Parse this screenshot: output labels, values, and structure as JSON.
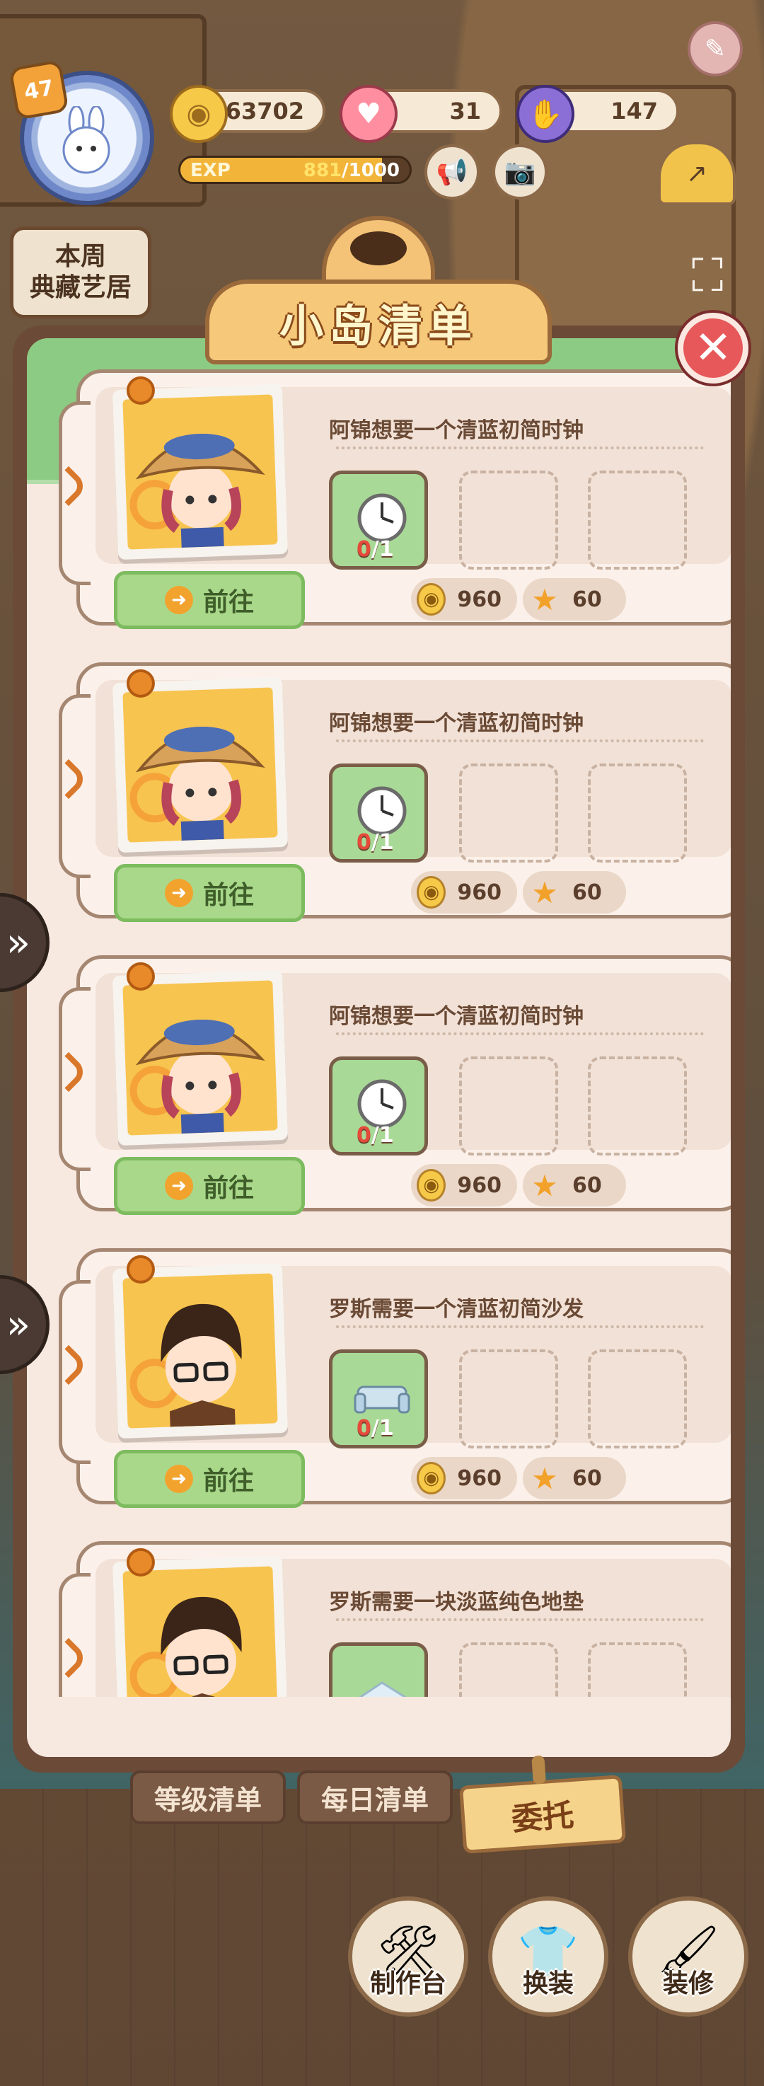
{
  "hud": {
    "level": "47",
    "coins": "63702",
    "hearts": "31",
    "gems": "147",
    "exp_label": "EXP",
    "exp_current": "881",
    "exp_sep_max": "/1000",
    "exp_fraction": 0.881,
    "weekly_line1": "本周",
    "weekly_line2": "典藏艺居"
  },
  "panel": {
    "title": "小岛清单",
    "close_symbol": "✕"
  },
  "tasks": [
    {
      "text": "阿锦想要一个清蓝初简时钟",
      "count_have": "0",
      "count_need": "/1",
      "item": "clock",
      "goto": "前往",
      "coin_reward": "960",
      "star_reward": "60",
      "character": "straw-hat-girl"
    },
    {
      "text": "阿锦想要一个清蓝初简时钟",
      "count_have": "0",
      "count_need": "/1",
      "item": "clock",
      "goto": "前往",
      "coin_reward": "960",
      "star_reward": "60",
      "character": "straw-hat-girl"
    },
    {
      "text": "阿锦想要一个清蓝初简时钟",
      "count_have": "0",
      "count_need": "/1",
      "item": "clock",
      "goto": "前往",
      "coin_reward": "960",
      "star_reward": "60",
      "character": "straw-hat-girl"
    },
    {
      "text": "罗斯需要一个清蓝初简沙发",
      "count_have": "0",
      "count_need": "/1",
      "item": "sofa",
      "goto": "前往",
      "coin_reward": "960",
      "star_reward": "60",
      "character": "glasses-boy"
    },
    {
      "text": "罗斯需要一块淡蓝纯色地垫",
      "count_have": "",
      "count_need": "",
      "item": "rug",
      "goto": "",
      "coin_reward": "",
      "star_reward": "",
      "character": "glasses-boy"
    }
  ],
  "tabs": {
    "level_list": "等级清单",
    "daily_list": "每日清单",
    "commission": "委托"
  },
  "bottom": {
    "craft": "制作台",
    "outfit": "换装",
    "decorate": "装修"
  },
  "colors": {
    "panel_frame": "#6b4a37",
    "panel_bg": "#f7e8e0",
    "goto_green": "#a9d88a",
    "title_gold": "#f6c879",
    "close_red": "#e7585a"
  }
}
